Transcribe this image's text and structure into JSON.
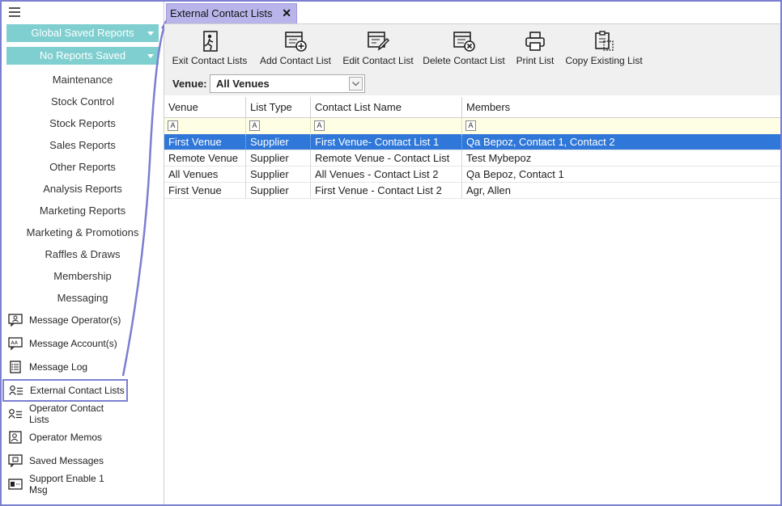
{
  "sidebar": {
    "dropdowns": [
      "Global Saved Reports",
      "No Reports Saved"
    ],
    "menu_items": [
      "Maintenance",
      "Stock Control",
      "Stock Reports",
      "Sales Reports",
      "Other Reports",
      "Analysis Reports",
      "Marketing Reports",
      "Marketing & Promotions",
      "Raffles & Draws",
      "Membership",
      "Messaging"
    ],
    "icon_items": [
      {
        "label": "Message Operator(s)",
        "icon": "operator-message-icon"
      },
      {
        "label": "Message Account(s)",
        "icon": "account-message-icon"
      },
      {
        "label": "Message Log",
        "icon": "log-icon"
      },
      {
        "label": "External Contact Lists",
        "icon": "contact-list-icon",
        "selected": true
      },
      {
        "label": "Operator Contact Lists",
        "icon": "contact-list-icon"
      },
      {
        "label": "Operator Memos",
        "icon": "memo-icon"
      },
      {
        "label": "Saved Messages",
        "icon": "saved-message-icon"
      },
      {
        "label": "Support Enable 1 Msg",
        "icon": "support-icon"
      }
    ]
  },
  "tab": {
    "title": "External Contact Lists",
    "close": "✕"
  },
  "toolbar": {
    "buttons": [
      "Exit Contact Lists",
      "Add Contact List",
      "Edit Contact List",
      "Delete Contact List",
      "Print List",
      "Copy Existing List"
    ]
  },
  "venue": {
    "label": "Venue:",
    "value": "All Venues"
  },
  "grid": {
    "columns": [
      "Venue",
      "List Type",
      "Contact List Name",
      "Members"
    ],
    "rows": [
      [
        "First Venue",
        "Supplier",
        "First Venue- Contact List 1",
        "Qa Bepoz, Contact 1, Contact 2"
      ],
      [
        "Remote Venue",
        "Supplier",
        "Remote Venue - Contact List",
        "Test Mybepoz"
      ],
      [
        "All Venues",
        "Supplier",
        "All Venues - Contact List 2",
        "Qa Bepoz, Contact 1"
      ],
      [
        "First Venue",
        "Supplier",
        "First Venue - Contact List 2",
        "Agr, Allen"
      ]
    ],
    "selected_row": 0
  },
  "colors": {
    "accent_teal": "#7fcfd0",
    "tab": "#b9b5ea",
    "selection": "#2f77d8",
    "frame": "#7b7fd0"
  }
}
